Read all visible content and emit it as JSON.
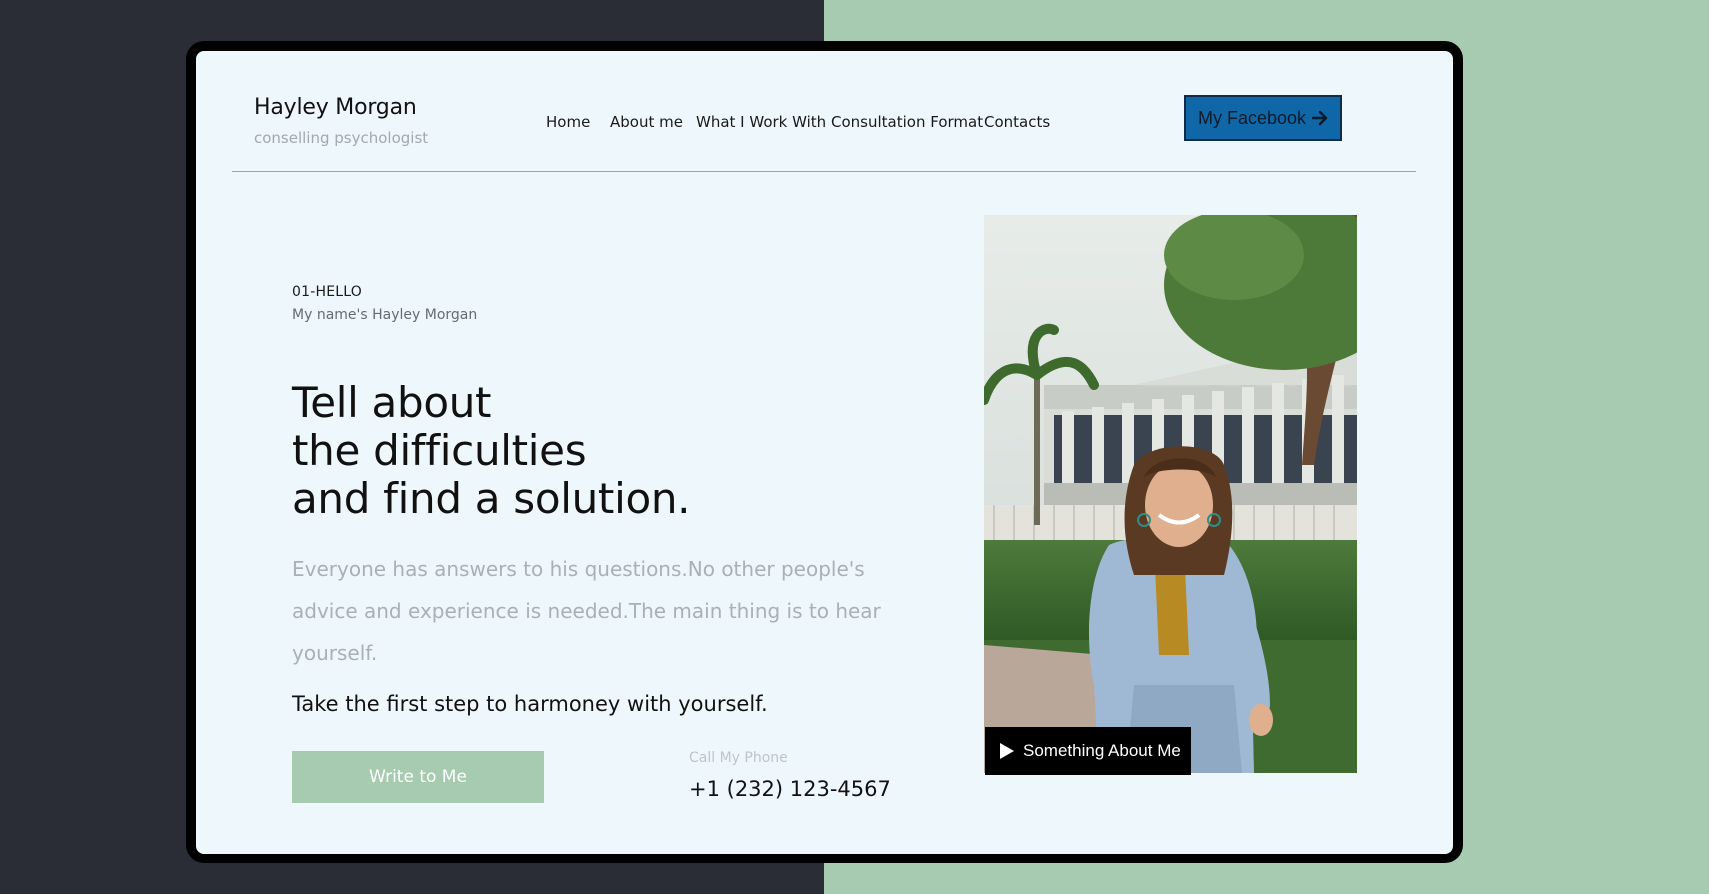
{
  "brand": {
    "name": "Hayley Morgan",
    "subtitle": "conselling psychologist"
  },
  "nav": {
    "items": [
      {
        "label": "Home"
      },
      {
        "label": "About me"
      },
      {
        "label": "What I Work With"
      },
      {
        "label": "Consultation Format"
      },
      {
        "label": "Contacts"
      }
    ],
    "facebook_button": {
      "label": "My Facebook",
      "icon": "arrow-right-icon"
    }
  },
  "hero": {
    "kicker": "01-HELLO",
    "kicker_sub": "My name's Hayley Morgan",
    "headline_lines": [
      "Tell about",
      "the difficulties",
      "and find a solution."
    ],
    "lead": "Everyone has answers to his questions.No other people's advice and experience is needed.The main thing is to hear yourself.",
    "cta_text": "Take the first step to harmoney with yourself.",
    "write_button": "Write to Me",
    "phone_label": "Call My Phone",
    "phone_number": "+1 (232) 123-4567"
  },
  "photo": {
    "video_button": "Something About Me",
    "video_icon": "play-icon"
  },
  "colors": {
    "left_bg": "#2a2d36",
    "right_bg": "#a6cbb1",
    "card_bg": "#eef7fc",
    "accent_green": "#a6cbb1",
    "facebook_blue": "#0f67a8"
  }
}
